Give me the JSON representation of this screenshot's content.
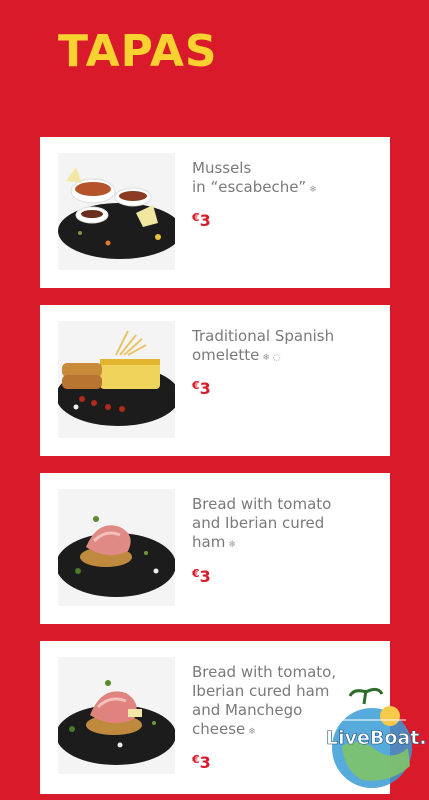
{
  "page": {
    "title": "TAPAS",
    "accent_color": "#d91a2a",
    "title_color": "#f7d230"
  },
  "items": [
    {
      "name_lines": [
        "Mussels",
        "in “escabeche”"
      ],
      "marks": "❄",
      "currency": "€",
      "price": "3",
      "image_icon": "mussels-dish-photo"
    },
    {
      "name_lines": [
        "Traditional Spanish",
        "omelette"
      ],
      "marks": "❄ ◌",
      "currency": "€",
      "price": "3",
      "image_icon": "omelette-dish-photo"
    },
    {
      "name_lines": [
        "Bread with tomato",
        "and Iberian cured",
        "ham"
      ],
      "marks": "❄",
      "currency": "€",
      "price": "3",
      "image_icon": "bread-ham-dish-photo"
    },
    {
      "name_lines": [
        "Bread with tomato,",
        "Iberian cured ham",
        "and Manchego",
        "cheese"
      ],
      "marks": "❄",
      "currency": "€",
      "price": "3",
      "image_icon": "bread-ham-cheese-dish-photo"
    }
  ],
  "watermark": {
    "text": "LiveBoat.it",
    "icon": "liveboat-logo"
  }
}
